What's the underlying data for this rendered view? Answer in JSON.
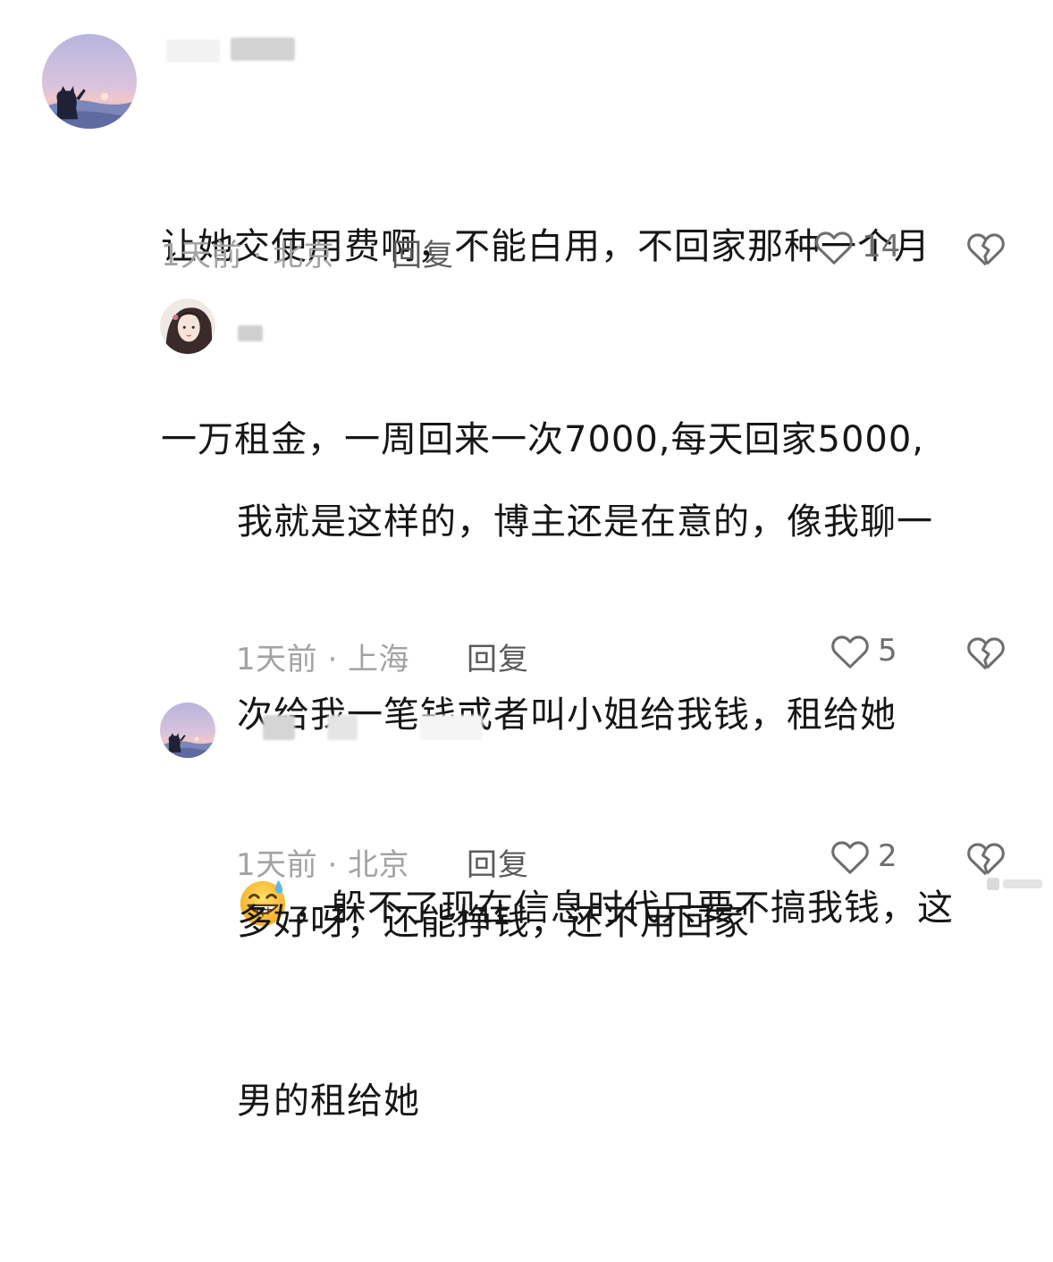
{
  "comments": [
    {
      "text_lines": [
        "让她交使用费啊，不能白用，不回家那种一个月",
        "一万租金，一周回来一次7000,每天回家5000,"
      ],
      "time_location": "1天前 · 北京",
      "reply_label": "回复",
      "likes": "14"
    },
    {
      "text_lines": [
        "我就是这样的，博主还是在意的，像我聊一",
        "次给我一笔钱或者叫小姐给我钱，租给她"
      ],
      "emoji_line_text": "，躲不了现在信息时代只要不搞我钱，这",
      "last_line": "男的租给她",
      "time_location": "1天前 · 上海",
      "reply_label": "回复",
      "likes": "5"
    },
    {
      "text_lines": [
        "多好呀，还能挣钱，还不用回家"
      ],
      "time_location": "1天前 · 北京",
      "reply_label": "回复",
      "likes": "2"
    }
  ],
  "icons": {
    "like": "heart-outline-icon",
    "dislike": "broken-heart-icon",
    "emoji": "grinning-sweat-emoji"
  },
  "colors": {
    "text": "#161616",
    "meta": "#a3a3a3",
    "reply": "#5a5a5a",
    "icon": "#6e6e6e"
  }
}
